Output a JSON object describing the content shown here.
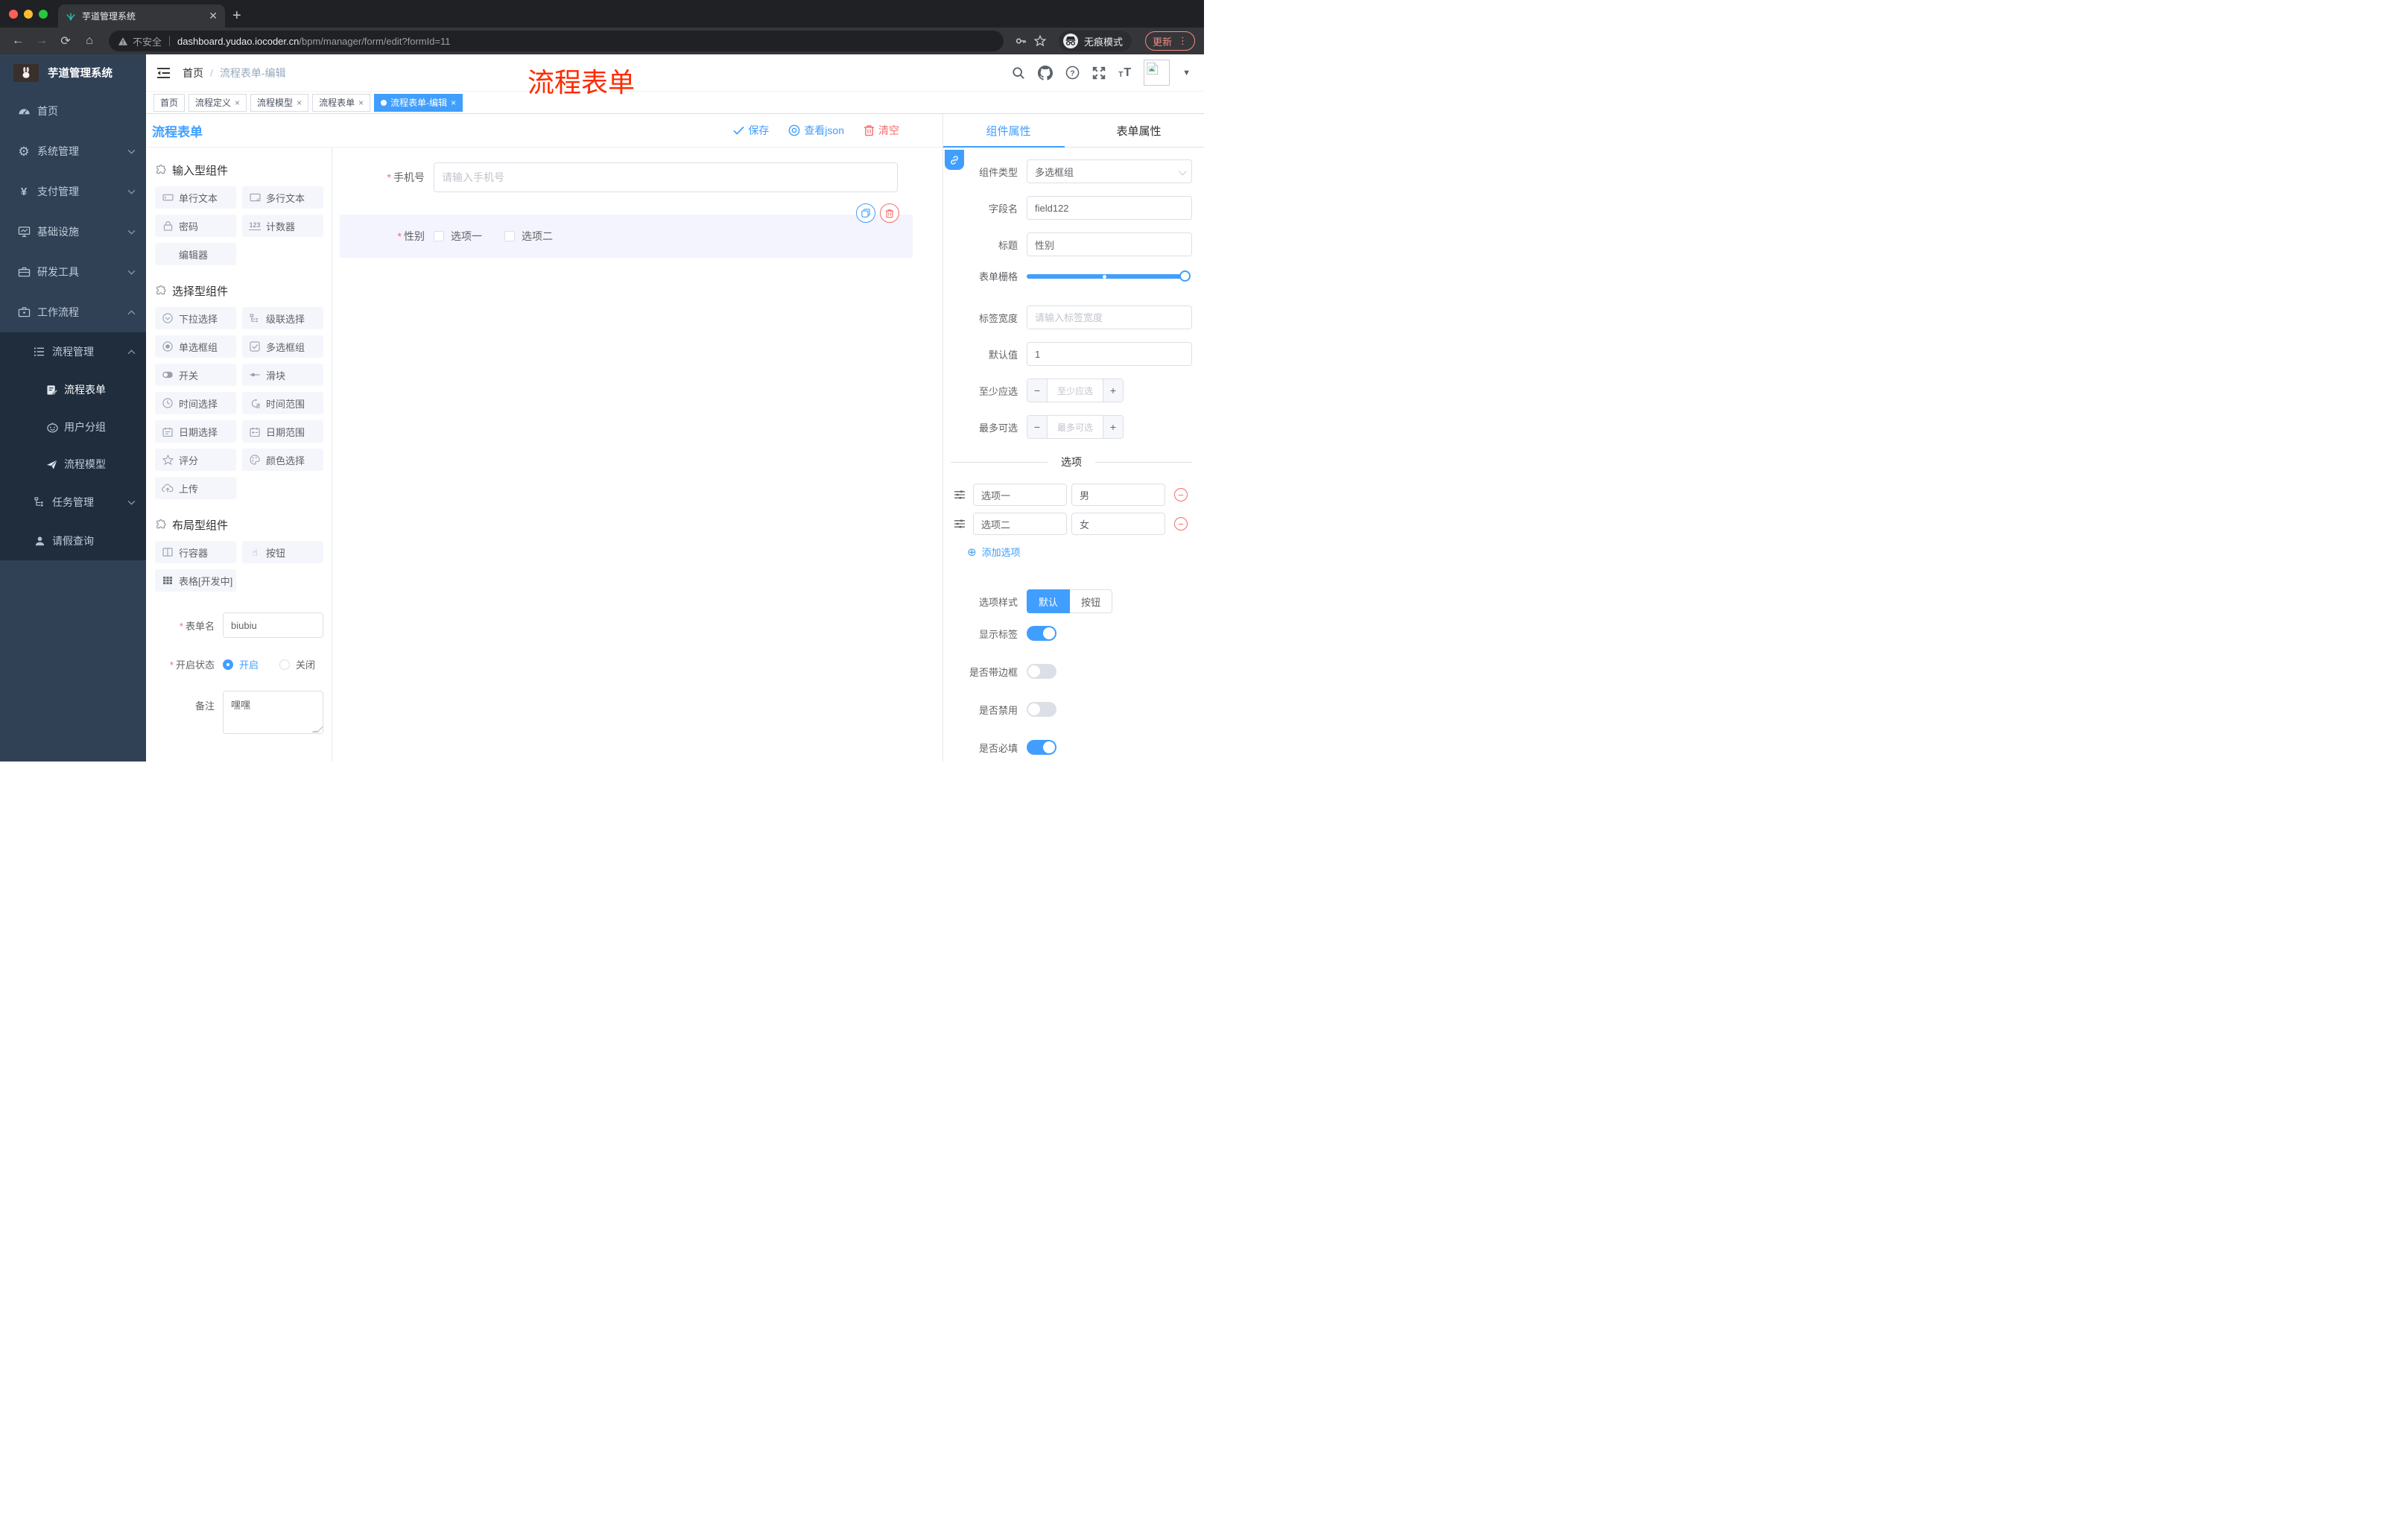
{
  "browser": {
    "tab_title": "芋道管理系统",
    "security_label": "不安全",
    "url_host": "dashboard.yudao.iocoder.cn",
    "url_path": "/bpm/manager/form/edit?formId=11",
    "incognito_label": "无痕模式",
    "update_label": "更新"
  },
  "sidebar": {
    "title": "芋道管理系统",
    "menu": [
      {
        "label": "首页"
      },
      {
        "label": "系统管理"
      },
      {
        "label": "支付管理"
      },
      {
        "label": "基础设施"
      },
      {
        "label": "研发工具"
      },
      {
        "label": "工作流程"
      }
    ],
    "submenu": [
      {
        "label": "流程管理"
      },
      {
        "label": "流程表单"
      },
      {
        "label": "用户分组"
      },
      {
        "label": "流程模型"
      },
      {
        "label": "任务管理"
      },
      {
        "label": "请假查询"
      }
    ]
  },
  "header": {
    "breadcrumb": {
      "home": "首页",
      "sep": "/",
      "current": "流程表单-编辑"
    },
    "watermark": "流程表单"
  },
  "tags": [
    {
      "label": "首页"
    },
    {
      "label": "流程定义"
    },
    {
      "label": "流程模型"
    },
    {
      "label": "流程表单"
    },
    {
      "label": "流程表单-编辑"
    }
  ],
  "toolbar": {
    "title": "流程表单",
    "save": "保存",
    "view_json": "查看json",
    "clear": "清空"
  },
  "palette": {
    "sections": [
      {
        "title": "输入型组件",
        "items": [
          "单行文本",
          "多行文本",
          "密码",
          "计数器",
          "编辑器"
        ]
      },
      {
        "title": "选择型组件",
        "items": [
          "下拉选择",
          "级联选择",
          "单选框组",
          "多选框组",
          "开关",
          "滑块",
          "时间选择",
          "时间范围",
          "日期选择",
          "日期范围",
          "评分",
          "颜色选择",
          "上传"
        ]
      },
      {
        "title": "布局型组件",
        "items": [
          "行容器",
          "按钮",
          "表格[开发中]"
        ]
      }
    ]
  },
  "form_settings": {
    "name_label": "表单名",
    "name_value": "biubiu",
    "status_label": "开启状态",
    "status_on": "开启",
    "status_off": "关闭",
    "remark_label": "备注",
    "remark_value": "嘿嘿"
  },
  "canvas": {
    "phone": {
      "label": "手机号",
      "placeholder": "请输入手机号"
    },
    "gender": {
      "label": "性别",
      "option1": "选项一",
      "option2": "选项二"
    }
  },
  "panel": {
    "tab_component": "组件属性",
    "tab_form": "表单属性",
    "type_label": "组件类型",
    "type_value": "多选框组",
    "field_label": "字段名",
    "field_value": "field122",
    "title_label": "标题",
    "title_value": "性别",
    "grid_label": "表单栅格",
    "label_width_label": "标签宽度",
    "label_width_placeholder": "请输入标签宽度",
    "default_label": "默认值",
    "default_value": "1",
    "min_label": "至少应选",
    "min_placeholder": "至少应选",
    "max_label": "最多可选",
    "max_placeholder": "最多可选",
    "options_title": "选项",
    "options": [
      {
        "label": "选项一",
        "value": "男"
      },
      {
        "label": "选项二",
        "value": "女"
      }
    ],
    "add_option": "添加选项",
    "style_label": "选项样式",
    "style_default": "默认",
    "style_button": "按钮",
    "show_label": "显示标签",
    "border_label": "是否带边框",
    "disabled_label": "是否禁用",
    "required_label": "是否必填"
  },
  "colors": {
    "primary": "#409eff",
    "danger": "#f56c6c",
    "sidebar": "#304156",
    "submenu": "#1f2d3d"
  }
}
